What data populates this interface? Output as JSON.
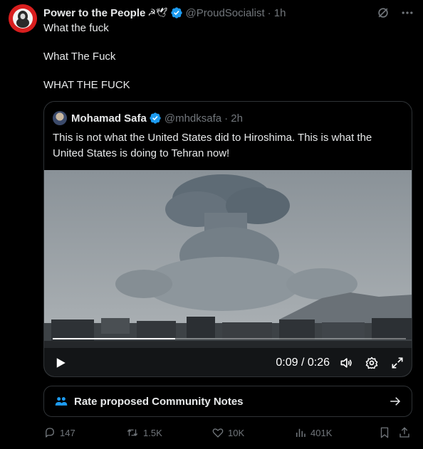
{
  "post": {
    "display_name": "Power to the People",
    "emoji": "☭🕊",
    "handle": "@ProudSocialist",
    "time": "· 1h",
    "lines": [
      "What the fuck",
      "What The Fuck",
      "WHAT THE FUCK"
    ]
  },
  "quote": {
    "display_name": "Mohamad Safa",
    "handle": "@mhdksafa",
    "time": "· 2h",
    "text": "This is not what the United States did to Hiroshima. This is what the United States is doing to Tehran now!"
  },
  "video": {
    "time_display": "0:09 / 0:26",
    "progress": 0.346
  },
  "community_notes": {
    "label": "Rate proposed Community Notes"
  },
  "actions": {
    "replies": "147",
    "reposts": "1.5K",
    "likes": "10K",
    "views": "401K"
  },
  "colors": {
    "background": "#000000",
    "text": "#e7e9ea",
    "muted": "#71767b",
    "border": "#2f3336",
    "verified": "#1d9bf0",
    "avatar_red": "#d81e1e"
  },
  "icons": [
    "grok-icon",
    "more-icon",
    "verified-badge-icon",
    "play-icon",
    "volume-icon",
    "settings-icon",
    "fullscreen-icon",
    "community-notes-icon",
    "arrow-right-icon",
    "reply-icon",
    "repost-icon",
    "like-icon",
    "views-icon",
    "bookmark-icon",
    "share-icon"
  ]
}
